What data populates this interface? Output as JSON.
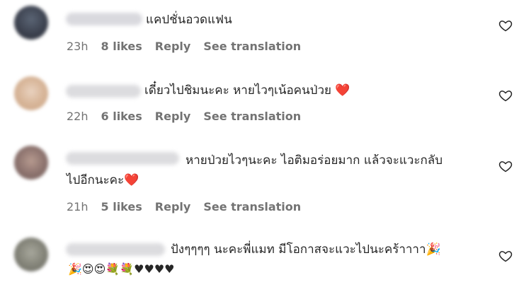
{
  "comments": [
    {
      "text_lines": [
        "แคปชั่นอวดแฟน"
      ],
      "time": "23h",
      "likes": "8 likes",
      "reply": "Reply",
      "translate": "See translation"
    },
    {
      "text_lines": [
        "เดี๋ยวไปชิมนะคะ หายไวๆเน้อคนป่วย ❤️"
      ],
      "time": "22h",
      "likes": "6 likes",
      "reply": "Reply",
      "translate": "See translation"
    },
    {
      "text_lines": [
        "หายป่วยไวๆนะคะ ไอติมอร่อยมาก แล้วจะแวะกลับ",
        "ไปอีกนะคะ❤️"
      ],
      "time": "21h",
      "likes": "5 likes",
      "reply": "Reply",
      "translate": "See translation"
    },
    {
      "text_lines": [
        "ปังๆๆๆๆ นะคะพี่แมท มีโอกาสจะแวะไปนะคร้าาาา🎉",
        "🎉😍😍💐💐♥♥♥♥"
      ]
    }
  ],
  "icons": {
    "like": "heart-outline-icon"
  },
  "colors": {
    "text": "#262626",
    "meta": "#737373",
    "heart_red": "#e0245e"
  }
}
